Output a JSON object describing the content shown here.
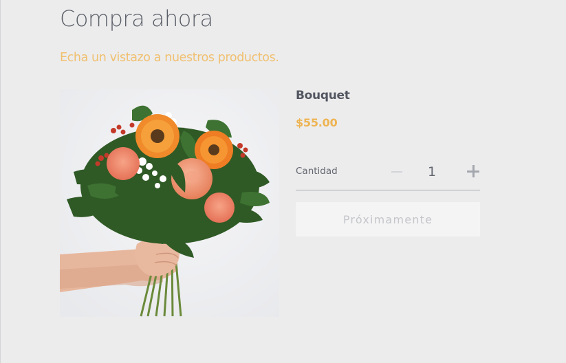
{
  "page": {
    "title": "Compra ahora",
    "subtitle": "Echa un vistazo a nuestros productos."
  },
  "product": {
    "image_subject": "bouquet-photo",
    "name": "Bouquet",
    "price": "$55.00"
  },
  "quantity": {
    "label": "Cantidad",
    "value": "1",
    "decrement_icon": "minus-icon",
    "increment_icon": "plus-icon"
  },
  "cta": {
    "label": "Próximamente",
    "disabled": true
  },
  "colors": {
    "background": "#ececed",
    "accent": "#eeb452",
    "subtitle": "#f0c070",
    "text": "#5a5e66"
  }
}
